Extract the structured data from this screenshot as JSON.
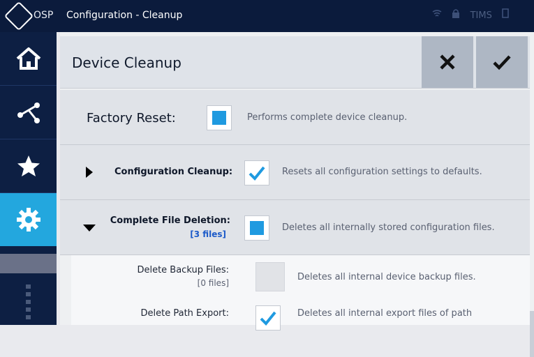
{
  "titlebar": {
    "app": "OSP",
    "title": "Configuration - Cleanup",
    "status_items": [
      "wifi-icon",
      "lock-icon",
      "TIMS",
      "window-icon"
    ]
  },
  "sidebar": {
    "items": [
      {
        "name": "home",
        "active": false
      },
      {
        "name": "connections",
        "active": false
      },
      {
        "name": "favorites",
        "active": false
      },
      {
        "name": "settings",
        "active": true
      }
    ]
  },
  "header": {
    "title": "Device Cleanup",
    "cancel_icon": "close-icon",
    "confirm_icon": "check-icon"
  },
  "rows": {
    "factory_reset": {
      "label": "Factory Reset:",
      "desc": "Performs complete device cleanup.",
      "checked": "filled"
    },
    "config_cleanup": {
      "label": "Configuration Cleanup:",
      "desc": "Resets all configuration settings to defaults.",
      "checked": "checkmark"
    },
    "file_deletion": {
      "label": "Complete File Deletion:",
      "count": "[3 files]",
      "desc": "Deletes all internally stored configuration files.",
      "checked": "filled"
    }
  },
  "subrows": {
    "backup": {
      "label": "Delete Backup Files:",
      "count": "[0 files]",
      "desc": "Deletes all internal device backup files.",
      "checked": "empty"
    },
    "path_export": {
      "label": "Delete Path Export:",
      "desc": "Deletes all internal export files of path",
      "checked": "checkmark"
    }
  },
  "colors": {
    "accent": "#1f9ae0",
    "sidebar": "#0d1f43",
    "titlebar": "#0b1b3c",
    "active": "#23a7de"
  }
}
